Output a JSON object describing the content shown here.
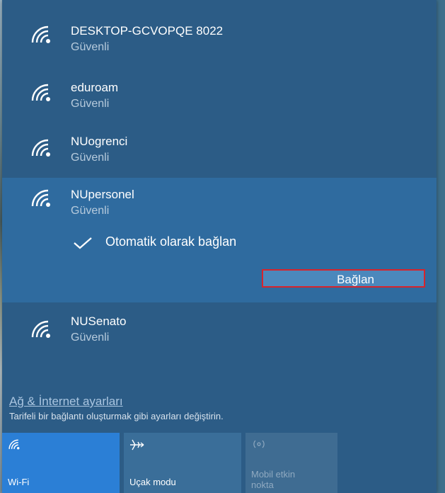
{
  "networks": [
    {
      "ssid": "DESKTOP-GCVOPQE 8022",
      "security": "Güvenli"
    },
    {
      "ssid": "eduroam",
      "security": "Güvenli"
    },
    {
      "ssid": "NUogrenci",
      "security": "Güvenli"
    },
    {
      "ssid": "NUpersonel",
      "security": "Güvenli",
      "auto_connect_label": "Otomatik olarak bağlan",
      "connect_label": "Bağlan"
    },
    {
      "ssid": "NUSenato",
      "security": "Güvenli"
    }
  ],
  "settings": {
    "link": "Ağ & İnternet ayarları",
    "description": "Tarifeli bir bağlantı oluşturmak gibi ayarları değiştirin."
  },
  "quick_actions": {
    "wifi": "Wi-Fi",
    "airplane": "Uçak modu",
    "hotspot_line1": "Mobil etkin",
    "hotspot_line2": "nokta"
  },
  "colors": {
    "panel": "#2c5c86",
    "selected": "#2f6b9f",
    "accent_tile": "#2b7fd6",
    "highlight_border": "#d7242c"
  }
}
